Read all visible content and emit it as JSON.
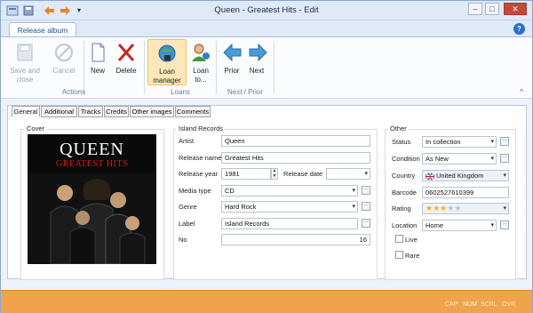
{
  "window": {
    "title": "Queen - Greatest Hits - Edit",
    "quick_access": [
      "app-icon",
      "save-icon",
      "back-arrow-icon",
      "forward-arrow-icon",
      "customize-icon"
    ]
  },
  "ribbon": {
    "tab": "Release album",
    "buttons": {
      "save_close": "Save and close",
      "cancel": "Cancel",
      "new": "New",
      "delete": "Delete",
      "loan_manager": "Loan manager",
      "loan_to": "Loan to...",
      "prior": "Prior",
      "next": "Next"
    },
    "groups": {
      "actions": "Actions",
      "loans": "Loans",
      "next_prior": "Next / Prior"
    }
  },
  "tabs": [
    "General",
    "Additional",
    "Tracks",
    "Credits",
    "Other images",
    "Comments"
  ],
  "cover": {
    "label": "Cover",
    "art_title": "QUEEN",
    "art_subtitle": "GREATEST HITS"
  },
  "release_info": {
    "label": "Island Records",
    "artist_label": "Artist",
    "artist": "Queen",
    "release_name_label": "Release name",
    "release_name": "Greatest Hits",
    "release_year_label": "Release year",
    "release_year": "1981",
    "release_date_label": "Release date",
    "release_date": "",
    "media_type_label": "Media type",
    "media_type": "CD",
    "genre_label": "Genre",
    "genre": "Hard Rock",
    "label_label": "Label",
    "no_label": "No",
    "no": "16"
  },
  "other": {
    "label": "Other",
    "status_label": "Status",
    "status": "In collection",
    "condition_label": "Condition",
    "condition": "As New",
    "country_label": "Country",
    "country": "United Kingdom",
    "barcode_label": "Barcode",
    "barcode": "0602527610399",
    "rating_label": "Rating",
    "rating_stars": 3,
    "rating_max": 5,
    "location_label": "Location",
    "location": "Home",
    "live_label": "Live",
    "rare_label": "Rare"
  },
  "statusbar": {
    "indicators": [
      "CAP",
      "NUM",
      "SCRL",
      "OVR"
    ]
  },
  "colors": {
    "statusbar": "#f0a34a",
    "ribbon_accent": "#1d4f91",
    "active_button": "#fde7b8"
  }
}
